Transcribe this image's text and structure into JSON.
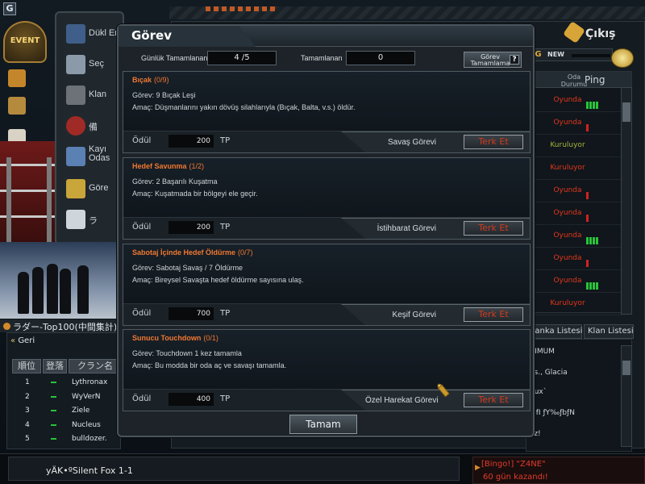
{
  "app": {
    "corner_badge": "G",
    "event_label": "EVENT"
  },
  "top_right": {
    "cikis": "Çıkış",
    "fragment_left": "n",
    "ng_label": "NG",
    "new_label": "NEW"
  },
  "left_menu": {
    "items": [
      {
        "label": "Dükl Env"
      },
      {
        "label": "Seç"
      },
      {
        "label": "Klan"
      },
      {
        "label": "備"
      },
      {
        "label": "Kayı Odas"
      },
      {
        "label": "Göre"
      },
      {
        "label": "ラ"
      }
    ]
  },
  "server_list": {
    "col_oda": "Oda Durumu",
    "col_ping": "Ping",
    "rows": [
      {
        "status": "Oyunda",
        "status_color": "#e4361d",
        "ping": "green4"
      },
      {
        "status": "Oyunda",
        "status_color": "#e4361d",
        "ping": "red1"
      },
      {
        "status": "Kuruluyor",
        "status_color": "#a6b23b",
        "ping": "none"
      },
      {
        "status": "Kuruluyor",
        "status_color": "#e4361d",
        "ping": "none"
      },
      {
        "status": "Oyunda",
        "status_color": "#e4361d",
        "ping": "red1"
      },
      {
        "status": "Oyunda",
        "status_color": "#e4361d",
        "ping": "red1"
      },
      {
        "status": "Oyunda",
        "status_color": "#e4361d",
        "ping": "green4"
      },
      {
        "status": "Oyunda",
        "status_color": "#e4361d",
        "ping": "red1"
      },
      {
        "status": "Oyunda",
        "status_color": "#e4361d",
        "ping": "green4"
      },
      {
        "status": "Kuruluyor",
        "status_color": "#e4361d",
        "ping": "none"
      }
    ]
  },
  "right_tabs": {
    "tab1": "Kanka Listesi",
    "tab2": "Klan Listesi"
  },
  "chat": {
    "lines": [
      "XIMUM",
      "es., Glacia",
      "nux`",
      "MfI ƒY‰ƒbƒN",
      "xz!"
    ]
  },
  "ladder": {
    "title": "ラダー-Top100(中間集計)",
    "back": "Geri",
    "col_rank": "順位",
    "col_reg": "登落",
    "col_clan": "クラン名",
    "rows": [
      {
        "rank": "1",
        "name": "Lythronax"
      },
      {
        "rank": "2",
        "name": "WyVerN"
      },
      {
        "rank": "3",
        "name": "Ziele"
      },
      {
        "rank": "4",
        "name": "Nucleus"
      },
      {
        "rank": "5",
        "name": "bulldozer."
      }
    ]
  },
  "bottom": {
    "player": "yÄK•ºSilent Fox 1-1",
    "notice_line1": "[Bingo!] \"Z4NE\"",
    "notice_line2": "60 gün kazandı!"
  },
  "dialog": {
    "title": "Görev",
    "gunluk_label": "Günlük Tamamlanan",
    "gunluk_value": "4 /5",
    "tamamlanan_label": "Tamamlanan",
    "tamamlanan_value": "0",
    "tamamlama_btn_line1": "Görev",
    "tamamlama_btn_line2": "Tamamlama",
    "help": "?",
    "odul_label": "Ödül",
    "tp_label": "TP",
    "terk_label": "Terk Et",
    "ok_label": "Tamam",
    "quests": [
      {
        "name": "Bıçak",
        "progress": "(0/9)",
        "line1": "Görev: 9 Bıçak Leşi",
        "line2": "Amaç: Düşmanlarını yakın dövüş silahlarıyla (Bıçak, Balta, v.s.) öldür.",
        "reward": "200",
        "type": "Savaş Görevi"
      },
      {
        "name": "Hedef Savunma",
        "progress": "(1/2)",
        "line1": "Görev: 2 Başarılı Kuşatma",
        "line2": "Amaç: Kuşatmada bir bölgeyi ele geçir.",
        "reward": "200",
        "type": "İstihbarat Görevi"
      },
      {
        "name": "Sabotaj İçinde Hedef Öldürme",
        "progress": "(0/7)",
        "line1": "Görev: Sabotaj Savaş / 7 Öldürme",
        "line2": "Amaç: Bireysel Savaşta hedef öldürme sayısına ulaş.",
        "reward": "700",
        "type": "Keşif Görevi"
      },
      {
        "name": "Sunucu Touchdown",
        "progress": "(0/1)",
        "line1": "Görev: Touchdown 1 kez tamamla",
        "line2": "Amaç: Bu modda bir oda aç ve savaşı tamamla.",
        "reward": "400",
        "type": "Özel Harekat Görevi"
      }
    ]
  }
}
